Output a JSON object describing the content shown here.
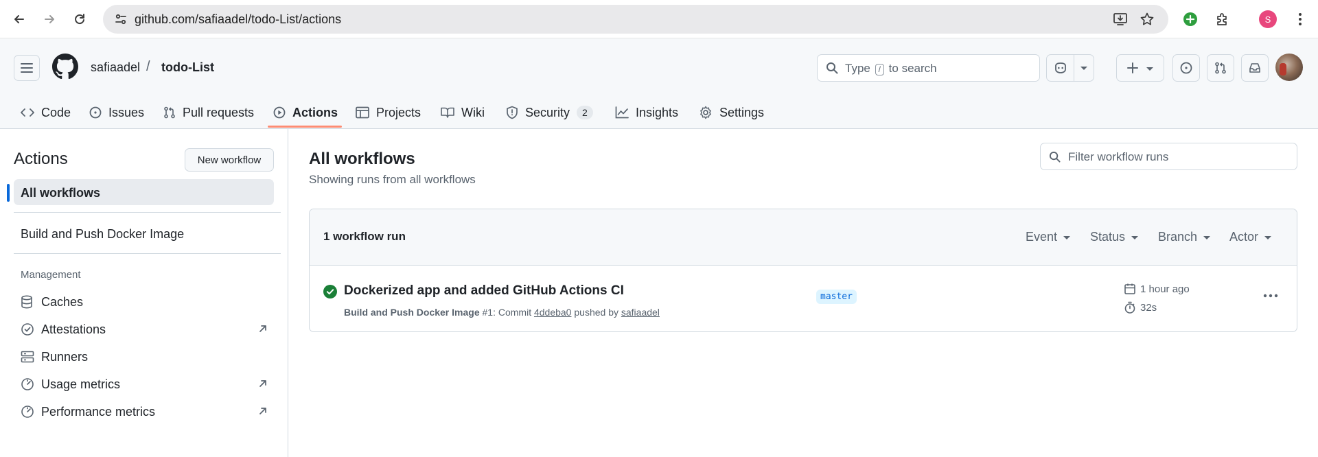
{
  "browser": {
    "url": "github.com/safiaadel/todo-List/actions",
    "profile_initial": "S"
  },
  "header": {
    "owner": "safiaadel",
    "separator": "/",
    "repo": "todo-List",
    "search": {
      "prefix": "Type",
      "key": "/",
      "suffix": "to search"
    }
  },
  "repo_nav": {
    "tabs": [
      {
        "label": "Code",
        "icon": "code-icon"
      },
      {
        "label": "Issues",
        "icon": "issue-icon"
      },
      {
        "label": "Pull requests",
        "icon": "pull-request-icon"
      },
      {
        "label": "Actions",
        "icon": "play-icon",
        "selected": true
      },
      {
        "label": "Projects",
        "icon": "table-icon"
      },
      {
        "label": "Wiki",
        "icon": "book-icon"
      },
      {
        "label": "Security",
        "icon": "shield-icon",
        "count": "2"
      },
      {
        "label": "Insights",
        "icon": "graph-icon"
      },
      {
        "label": "Settings",
        "icon": "gear-icon"
      }
    ]
  },
  "sidebar": {
    "title": "Actions",
    "new_workflow": "New workflow",
    "all_workflows": "All workflows",
    "workflow": "Build and Push Docker Image",
    "management_heading": "Management",
    "management": [
      {
        "label": "Caches",
        "icon": "database-icon"
      },
      {
        "label": "Attestations",
        "icon": "verified-icon"
      },
      {
        "label": "Runners",
        "icon": "server-icon"
      },
      {
        "label": "Usage metrics",
        "icon": "meter-icon"
      },
      {
        "label": "Performance metrics",
        "icon": "meter-icon"
      }
    ]
  },
  "main": {
    "title": "All workflows",
    "subtitle": "Showing runs from all workflows",
    "filter_placeholder": "Filter workflow runs",
    "runs_count": "1 workflow run",
    "filters": [
      "Event",
      "Status",
      "Branch",
      "Actor"
    ],
    "run": {
      "title": "Dockerized app and added GitHub Actions CI",
      "workflow": "Build and Push Docker Image",
      "number": "#1",
      "commit_prefix": ": Commit",
      "commit": "4ddeba0",
      "pushed_by": "pushed by",
      "actor": "safiaadel",
      "branch": "master",
      "time": "1 hour ago",
      "duration": "32s",
      "status_color": "#1a7f37"
    }
  }
}
